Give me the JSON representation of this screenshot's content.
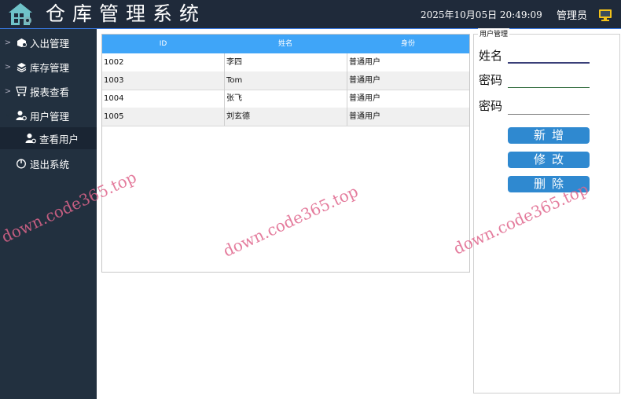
{
  "header": {
    "title": "仓库管理系统",
    "datetime": "2025年10月05日 20:49:09",
    "user_label": "管理员"
  },
  "sidebar": {
    "items": [
      {
        "label": "入出管理",
        "icon": "box-icon",
        "chevron": ">"
      },
      {
        "label": "库存管理",
        "icon": "layers-icon",
        "chevron": ">"
      },
      {
        "label": "报表查看",
        "icon": "cart-icon",
        "chevron": ">"
      },
      {
        "label": "用户管理",
        "icon": "user-gear-icon",
        "chevron": "v"
      },
      {
        "label": "查看用户",
        "icon": "user-gear-icon",
        "sub": true,
        "active": true
      },
      {
        "label": "退出系统",
        "icon": "power-icon"
      }
    ]
  },
  "table": {
    "columns": [
      "ID",
      "姓名",
      "身份"
    ],
    "rows": [
      [
        "1002",
        "李四",
        "普通用户"
      ],
      [
        "1003",
        "Tom",
        "普通用户"
      ],
      [
        "1004",
        "张飞",
        "普通用户"
      ],
      [
        "1005",
        "刘玄德",
        "普通用户"
      ]
    ]
  },
  "user_panel": {
    "title": "用户管理",
    "name_label": "姓名",
    "password_label": "密码",
    "password_confirm_label": "密码",
    "name_value": "",
    "password_value": "",
    "password_confirm_value": "",
    "add_label": "新增",
    "edit_label": "修改",
    "delete_label": "删除"
  },
  "watermark": "down.code365.top",
  "colors": {
    "header_bg": "#1f2a3a",
    "sidebar_bg": "#22303f",
    "table_header_bg": "#3fa5f8",
    "button_bg": "#2f89d0",
    "watermark": "#e0668c"
  }
}
